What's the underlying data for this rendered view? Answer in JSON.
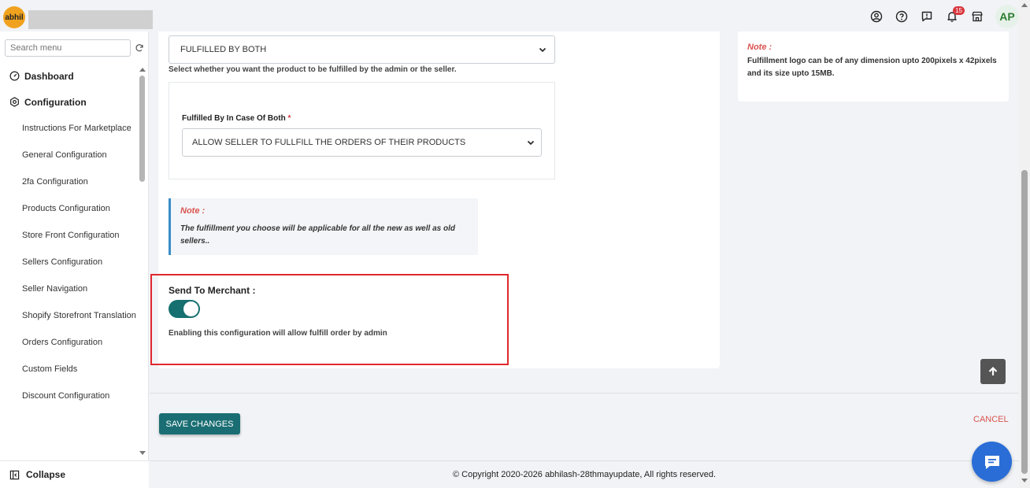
{
  "header": {
    "logo_text": "abhil",
    "notification_count": "15",
    "avatar_initials": "AP",
    "icons": [
      "user-circle-icon",
      "help-icon",
      "feedback-icon",
      "bell-icon",
      "store-icon"
    ]
  },
  "sidebar": {
    "search_placeholder": "Search menu",
    "items": [
      {
        "label": "Dashboard",
        "icon": "dashboard-icon",
        "type": "main"
      },
      {
        "label": "Configuration",
        "icon": "gear-icon",
        "type": "main"
      },
      {
        "label": "Instructions For Marketplace",
        "type": "sub"
      },
      {
        "label": "General Configuration",
        "type": "sub"
      },
      {
        "label": "2fa Configuration",
        "type": "sub"
      },
      {
        "label": "Products Configuration",
        "type": "sub"
      },
      {
        "label": "Store Front Configuration",
        "type": "sub"
      },
      {
        "label": "Sellers Configuration",
        "type": "sub"
      },
      {
        "label": "Seller Navigation",
        "type": "sub"
      },
      {
        "label": "Shopify Storefront Translation",
        "type": "sub"
      },
      {
        "label": "Orders Configuration",
        "type": "sub"
      },
      {
        "label": "Custom Fields",
        "type": "sub"
      },
      {
        "label": "Discount Configuration",
        "type": "sub"
      }
    ],
    "collapse_label": "Collapse"
  },
  "main": {
    "fulfilled_by_value": "FULFILLED BY BOTH",
    "fulfilled_by_help": "Select whether you want the product to be fulfilled by the admin or the seller.",
    "both_case_label": "Fulfilled By In Case Of Both",
    "both_case_required": "*",
    "both_case_value": "ALLOW SELLER TO FULLFILL THE ORDERS OF THEIR PRODUCTS",
    "note_title": "Note :",
    "note_text": "The fulfillment you choose will be applicable for all the new as well as old sellers..",
    "send_to_merchant_title": "Send To Merchant :",
    "send_to_merchant_enabled": true,
    "send_to_merchant_desc": "Enabling this configuration will allow fulfill order by admin"
  },
  "right_note": {
    "title": "Note :",
    "text": "Fulfillment logo can be of any dimension upto 200pixels x 42pixels and its size upto 15MB."
  },
  "actions": {
    "save_label": "SAVE CHANGES",
    "cancel_label": "CANCEL"
  },
  "footer": {
    "copyright": "© Copyright 2020-2026 abhilash-28thmayupdate, All rights reserved."
  },
  "colors": {
    "primary": "#1a6e73",
    "toggle_on": "#15706f",
    "note_red": "#d9534f",
    "highlight_border": "#e0282e",
    "chat_blue": "#2a6dd6",
    "logo_orange": "#f0a21f"
  }
}
